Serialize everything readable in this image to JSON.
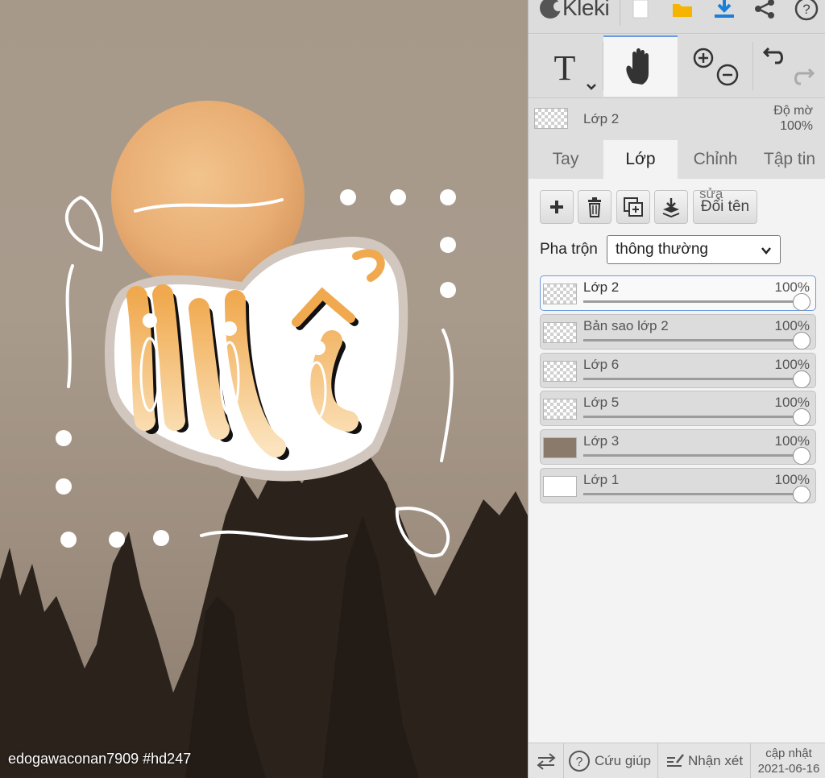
{
  "canvas": {
    "credit": "edogawaconan7909  #hd247",
    "artwork_text": "Nế"
  },
  "app": {
    "name": "Kleki",
    "icons": [
      "new-image-icon",
      "open-folder-icon",
      "download-icon",
      "share-icon",
      "help-icon"
    ],
    "accent_color": "#1a7fd8"
  },
  "tools": {
    "items": [
      "text-tool-icon",
      "hand-tool-icon",
      "zoom-in-icon",
      "zoom-out-icon",
      "undo-icon",
      "redo-icon"
    ],
    "active": "hand"
  },
  "layer_info": {
    "name": "Lớp 2",
    "opacity_label": "Độ mờ",
    "opacity_value": "100%"
  },
  "tabs": [
    {
      "label": "Tay",
      "active": false
    },
    {
      "label": "Lớp",
      "active": true
    },
    {
      "label": "Chỉnh",
      "active": false
    },
    {
      "label": "Tập tin",
      "active": false
    }
  ],
  "layer_buttons": {
    "rename_ghost": "sửa",
    "rename": "Đổi tên"
  },
  "blend": {
    "label": "Pha trộn",
    "value": "thông thường"
  },
  "layers": [
    {
      "name": "Lớp 2",
      "opacity": "100%",
      "active": true
    },
    {
      "name": "Bản sao lớp 2",
      "opacity": "100%",
      "active": false
    },
    {
      "name": "Lớp 6",
      "opacity": "100%",
      "active": false
    },
    {
      "name": "Lớp 5",
      "opacity": "100%",
      "active": false
    },
    {
      "name": "Lớp 3",
      "opacity": "100%",
      "active": false
    },
    {
      "name": "Lớp 1",
      "opacity": "100%",
      "active": false
    }
  ],
  "bottom": {
    "help": "Cứu giúp",
    "feedback": "Nhận xét",
    "update_label": "cập nhật",
    "update_date": "2021-06-16"
  }
}
